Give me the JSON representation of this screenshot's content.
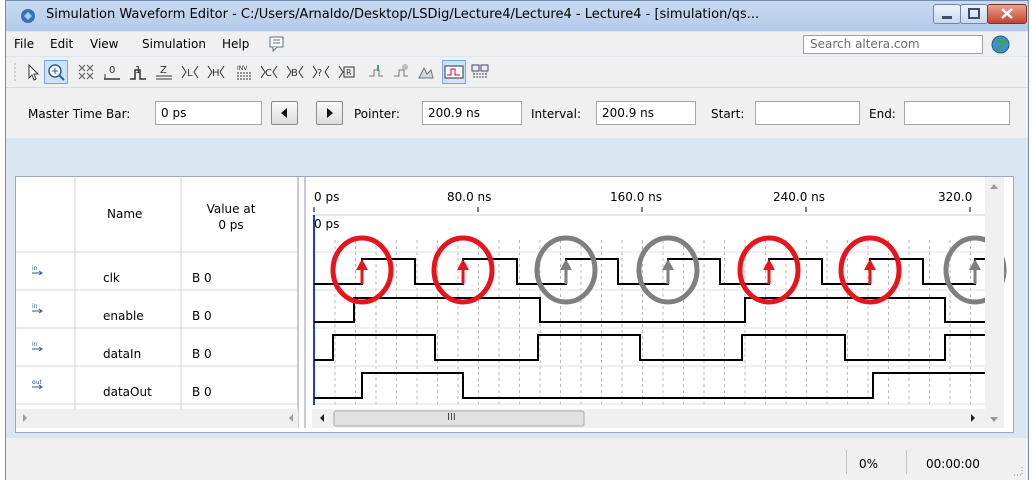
{
  "window": {
    "title": "Simulation Waveform Editor - C:/Users/Arnaldo/Desktop/LSDig/Lecture4/Lecture4 - Lecture4 - [simulation/qs..."
  },
  "menu": {
    "items": [
      "File",
      "Edit",
      "View",
      "Simulation",
      "Help"
    ],
    "search_placeholder": "Search altera.com"
  },
  "toolbar": {
    "icons": [
      "pointer-tool-icon",
      "zoom-tool-icon",
      "uninitialized-icon",
      "force-low-icon",
      "force-high-icon",
      "high-impedance-icon",
      "weak-low-icon",
      "weak-high-icon",
      "invert-icon",
      "count-value-icon",
      "arbitrary-value-icon",
      "random-value-icon",
      "overwrite-clock-icon",
      "snap-icon",
      "sort-icon",
      "grid-icon",
      "waveform-compare-icon",
      "group-icon"
    ]
  },
  "timebar": {
    "master_label": "Master Time Bar:",
    "master_value": "0 ps",
    "pointer_label": "Pointer:",
    "pointer_value": "200.9 ns",
    "interval_label": "Interval:",
    "interval_value": "200.9 ns",
    "start_label": "Start:",
    "start_value": "",
    "end_label": "End:",
    "end_value": ""
  },
  "grid": {
    "name_header": "Name",
    "value_header_line1": "Value at",
    "value_header_line2": "0 ps",
    "time_labels": [
      "0 ps",
      "80.0 ns",
      "160.0 ns",
      "240.0 ns",
      "320.0"
    ],
    "cursor_label": "0 ps",
    "scroll_marker": "III",
    "signals": [
      {
        "direction": "in",
        "name": "clk",
        "value": "B 0"
      },
      {
        "direction": "in",
        "name": "enable",
        "value": "B 0"
      },
      {
        "direction": "in",
        "name": "dataIn",
        "value": "B 0"
      },
      {
        "direction": "out",
        "name": "dataOut",
        "value": "B 0"
      }
    ]
  },
  "status": {
    "progress": "0%",
    "elapsed": "00:00:00"
  },
  "colors": {
    "highlight_active": "#e8141c",
    "highlight_inactive": "#7f7f7f",
    "cursor_line": "#1f3fbf"
  }
}
